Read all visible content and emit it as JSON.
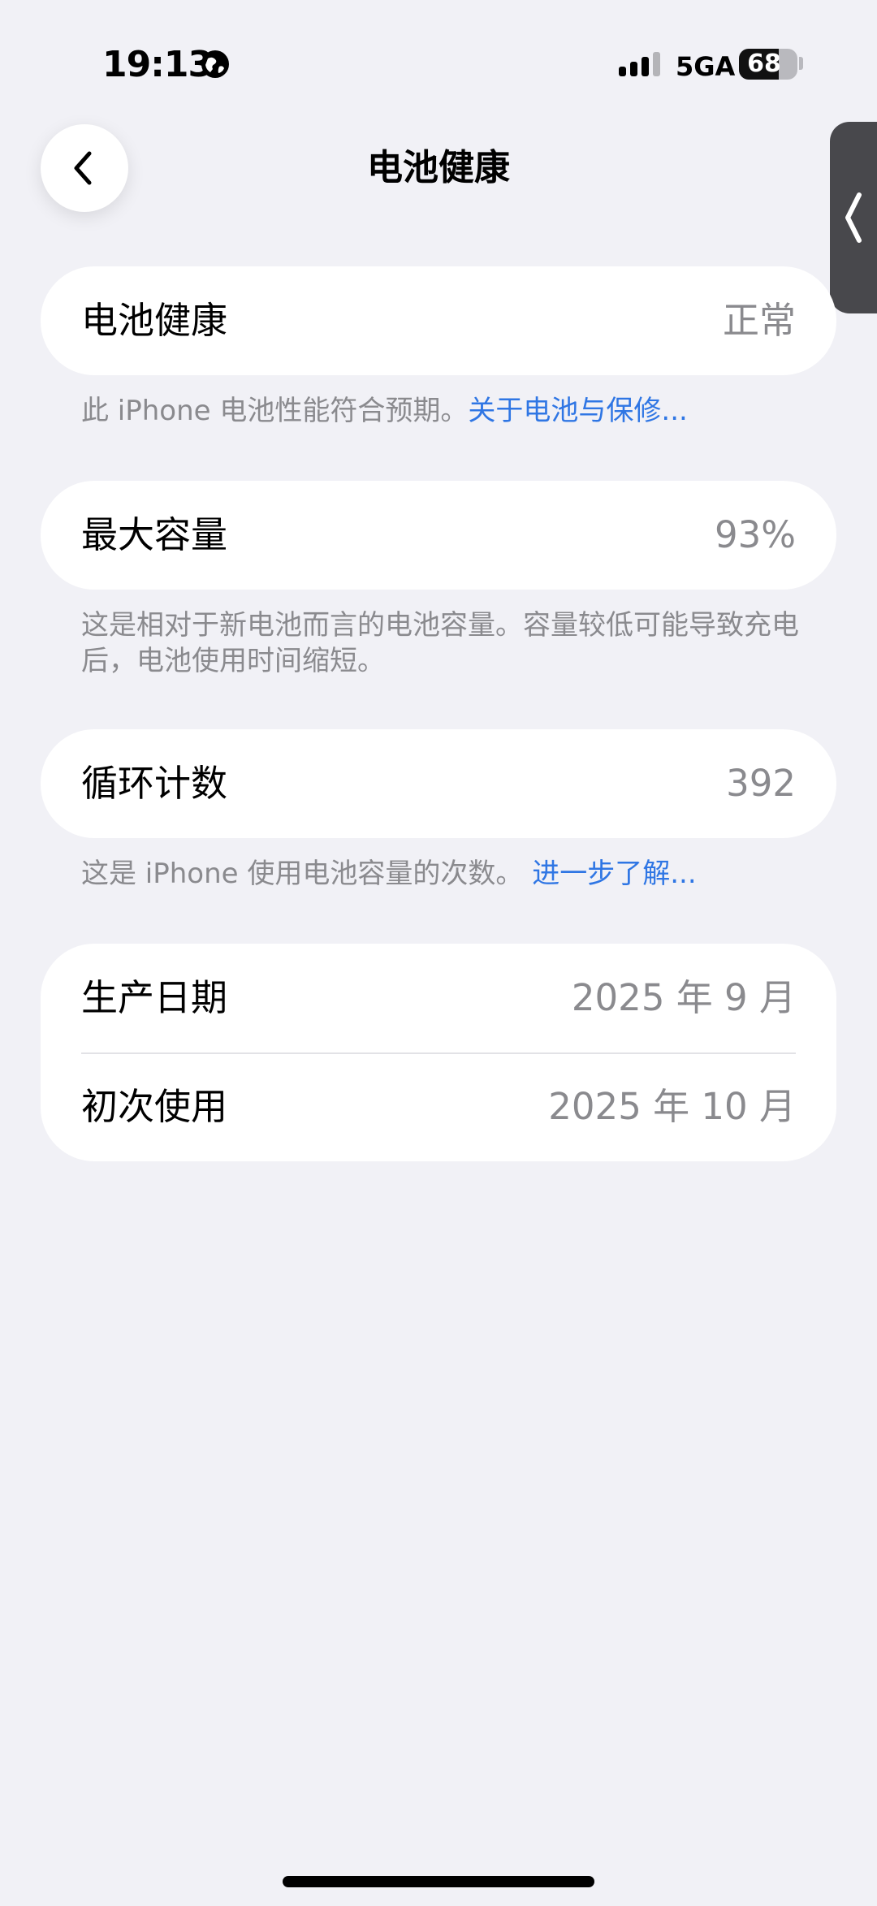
{
  "status_bar": {
    "time": "19:13",
    "network": "5GA",
    "battery_level": "68",
    "battery_fraction": 0.68,
    "location_icon": "globe-icon",
    "signal_icon": "cellular-signal-icon"
  },
  "nav": {
    "title": "电池健康",
    "back_icon": "chevron-left-icon",
    "side_handle_icon": "chevron-left-icon"
  },
  "sections": {
    "health": {
      "label": "电池健康",
      "value": "正常",
      "footnote": "此 iPhone 电池性能符合预期。",
      "footnote_link": "关于电池与保修..."
    },
    "capacity": {
      "label": "最大容量",
      "value": "93%",
      "footnote": "这是相对于新电池而言的电池容量。容量较低可能导致充电后，电池使用时间缩短。"
    },
    "cycles": {
      "label": "循环计数",
      "value": "392",
      "footnote": "这是 iPhone 使用电池容量的次数。",
      "footnote_link": "进一步了解..."
    },
    "dates": {
      "manufacture_label": "生产日期",
      "manufacture_value": "2025 年 9 月",
      "first_use_label": "初次使用",
      "first_use_value": "2025 年 10 月"
    }
  },
  "colors": {
    "background": "#f1f1f6",
    "link": "#2f76e4",
    "secondary_text": "#8a8a8e"
  }
}
